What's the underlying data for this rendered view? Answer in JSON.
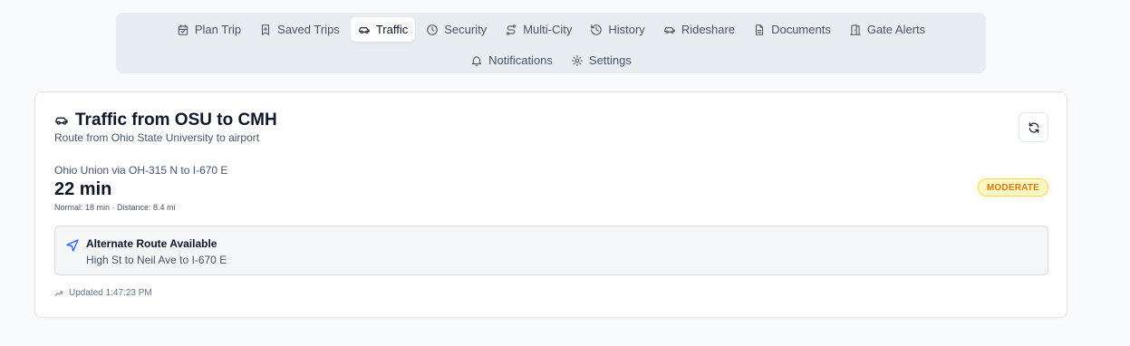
{
  "nav": {
    "row1": [
      {
        "label": "Plan Trip",
        "icon": "calendar-icon"
      },
      {
        "label": "Saved Trips",
        "icon": "bookmark-icon"
      },
      {
        "label": "Traffic",
        "icon": "car-icon",
        "active": true
      },
      {
        "label": "Security",
        "icon": "clock-icon"
      },
      {
        "label": "Multi-City",
        "icon": "route-icon"
      },
      {
        "label": "History",
        "icon": "history-icon"
      },
      {
        "label": "Rideshare",
        "icon": "car-icon"
      },
      {
        "label": "Documents",
        "icon": "file-icon"
      },
      {
        "label": "Gate Alerts",
        "icon": "door-icon"
      }
    ],
    "row2": [
      {
        "label": "Notifications",
        "icon": "bell-icon"
      },
      {
        "label": "Settings",
        "icon": "gear-icon"
      }
    ]
  },
  "card": {
    "title": "Traffic from OSU to CMH",
    "subtitle": "Route from Ohio State University to airport",
    "route_name": "Ohio Union via OH-315 N to I-670 E",
    "duration": "22 min",
    "details": "Normal: 18 min · Distance: 8.4 mi",
    "status_badge": "MODERATE",
    "alternate": {
      "title": "Alternate Route Available",
      "description": "High St to Neil Ave to I-670 E"
    },
    "updated": "Updated 1:47:23 PM"
  },
  "colors": {
    "accent": "#2563eb",
    "moderate": "#d97706",
    "moderate_bg": "#fef9c3"
  }
}
